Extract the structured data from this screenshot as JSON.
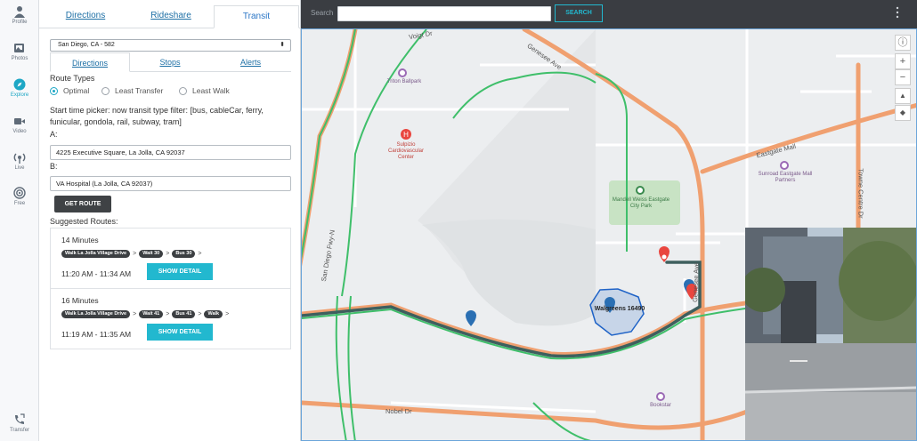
{
  "nav": {
    "items": [
      {
        "label": "Profile",
        "icon": "person-icon"
      },
      {
        "label": "Photos",
        "icon": "photos-icon"
      },
      {
        "label": "Explore",
        "icon": "compass-icon",
        "active": true
      },
      {
        "label": "Video",
        "icon": "video-icon"
      },
      {
        "label": "Live",
        "icon": "live-icon"
      },
      {
        "label": "Free",
        "icon": "free-icon"
      }
    ],
    "transfer_label": "Transfer"
  },
  "tabs": {
    "directions": "Directions",
    "rideshare": "Rideshare",
    "transit": "Transit",
    "active": "Transit"
  },
  "route_select": {
    "value": "San Diego, CA - 582"
  },
  "sub_tabs": {
    "directions": "Directions",
    "stops": "Stops",
    "alerts": "Alerts",
    "active": "Directions"
  },
  "route_types": {
    "heading": "Route Types",
    "options": [
      "Optimal",
      "Least Transfer",
      "Least Walk"
    ],
    "selected": "Optimal"
  },
  "info_text": "Start time picker: now transit type filter: [bus, cableCar, ferry, funicular, gondola, rail, subway, tram]",
  "from": {
    "label": "A:",
    "value": "4225 Executive Square, La Jolla, CA 92037"
  },
  "to": {
    "label": "B:",
    "value": "VA Hospital (La Jolla, CA 92037)"
  },
  "get_route_label": "GET ROUTE",
  "suggested_heading": "Suggested Routes:",
  "routes": [
    {
      "minutes": "14 Minutes",
      "steps": [
        "Walk La Jolla Village Drive",
        "Wait 30",
        "Bus 30"
      ],
      "time": "11:20 AM - 11:34 AM",
      "button": "SHOW DETAIL"
    },
    {
      "minutes": "16 Minutes",
      "steps": [
        "Walk La Jolla Village Drive",
        "Wait 41",
        "Bus 41",
        "Walk"
      ],
      "time": "11:19 AM - 11:35 AM",
      "button": "SHOW DETAIL"
    }
  ],
  "search": {
    "label": "Search",
    "button": "SEARCH"
  },
  "map": {
    "streets": {
      "voigt": "Voigt Dr",
      "genesee_ave_top": "Genesee Ave",
      "eastgate": "Eastgate Mall",
      "town_centre": "Towne Centre Dr",
      "san_diego_fwy": "San Diego Fwy-N",
      "genesee_ave_right": "Genesee Ave",
      "nobel": "Nobel Dr"
    },
    "pois": {
      "triton": "Triton Ballpark",
      "sulpizio": "Sulpizio Cardiovascular Center",
      "sunroad": "Sunroad Eastgate Mall Partners",
      "mandell": "Mandell Weiss Eastgate City Park",
      "walgreens": "Walgreens 16490",
      "bookstar": "Bookstar"
    },
    "colors": {
      "route": "#3e5f5e",
      "highway": "#f0a070",
      "transit_line": "#3fbf6a",
      "isochrone": "#1f63c7"
    }
  }
}
